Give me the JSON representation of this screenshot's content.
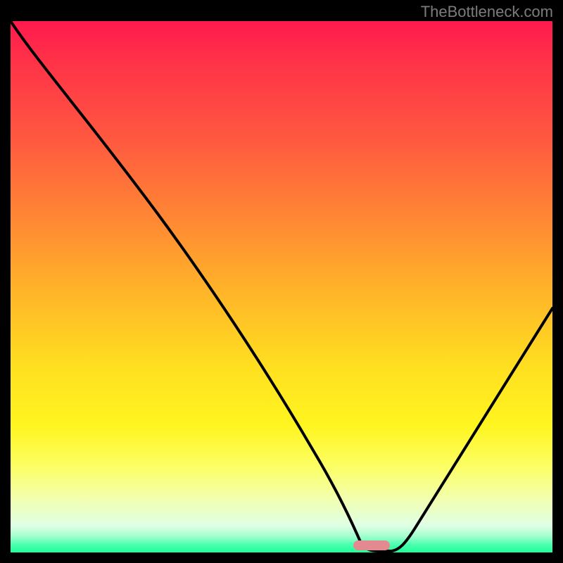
{
  "watermark": "TheBottleneck.com",
  "colors": {
    "gradient_top": "#ff1a4d",
    "gradient_mid": "#ffdf20",
    "gradient_bottom": "#1eff99",
    "curve": "#000000",
    "marker": "#e28a8f",
    "frame": "#000000"
  },
  "chart_data": {
    "type": "line",
    "title": "",
    "xlabel": "",
    "ylabel": "",
    "xlim": [
      0,
      100
    ],
    "ylim": [
      0,
      100
    ],
    "x": [
      0,
      10,
      20,
      28,
      40,
      50,
      56,
      60,
      63,
      65,
      68,
      72,
      80,
      90,
      100
    ],
    "values": [
      100,
      88,
      74,
      63,
      45,
      30,
      20,
      12,
      4,
      0,
      0,
      2,
      14,
      30,
      46
    ],
    "annotations": [
      {
        "kind": "pill-marker",
        "x": 66.5,
        "y": 0.6
      }
    ],
    "note": "y is an inverse-goodness score: curve descends from top-left, reaches 0 (optimal, green band) near x≈65–68, then rises toward the right. Values are read off the vertical gradient where 100 = top (red) and 0 = bottom (green)."
  }
}
